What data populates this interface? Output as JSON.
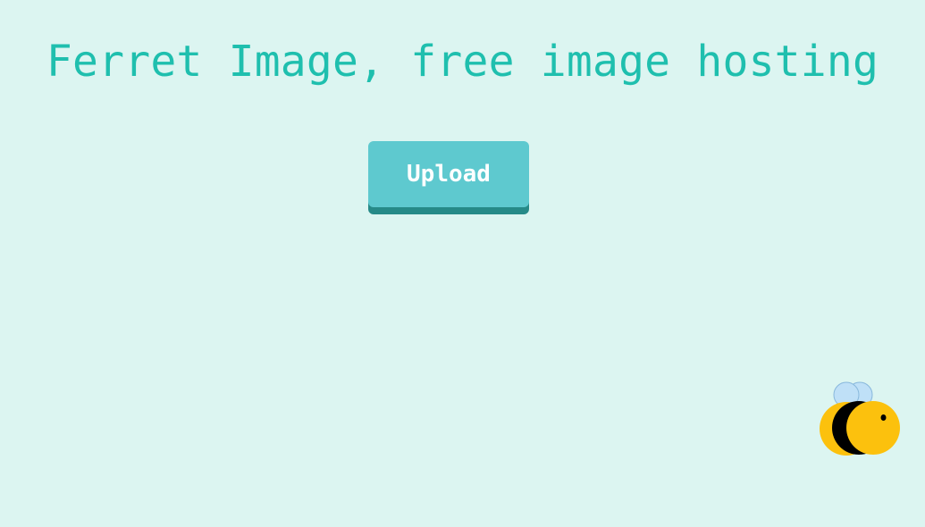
{
  "header": {
    "title": "Ferret Image, free image hosting"
  },
  "actions": {
    "upload_label": "Upload"
  },
  "mascot": {
    "icon": "bee-icon"
  },
  "colors": {
    "background": "#dcf5f1",
    "title": "#1fbfae",
    "button": "#5ec9cf",
    "button_shadow": "#268a88",
    "button_text": "#ffffff",
    "bee_body": "#fcc10d",
    "bee_stripe": "#000000",
    "bee_wing": "#bfe0f7",
    "bee_wing_outline": "#88b8dc"
  }
}
